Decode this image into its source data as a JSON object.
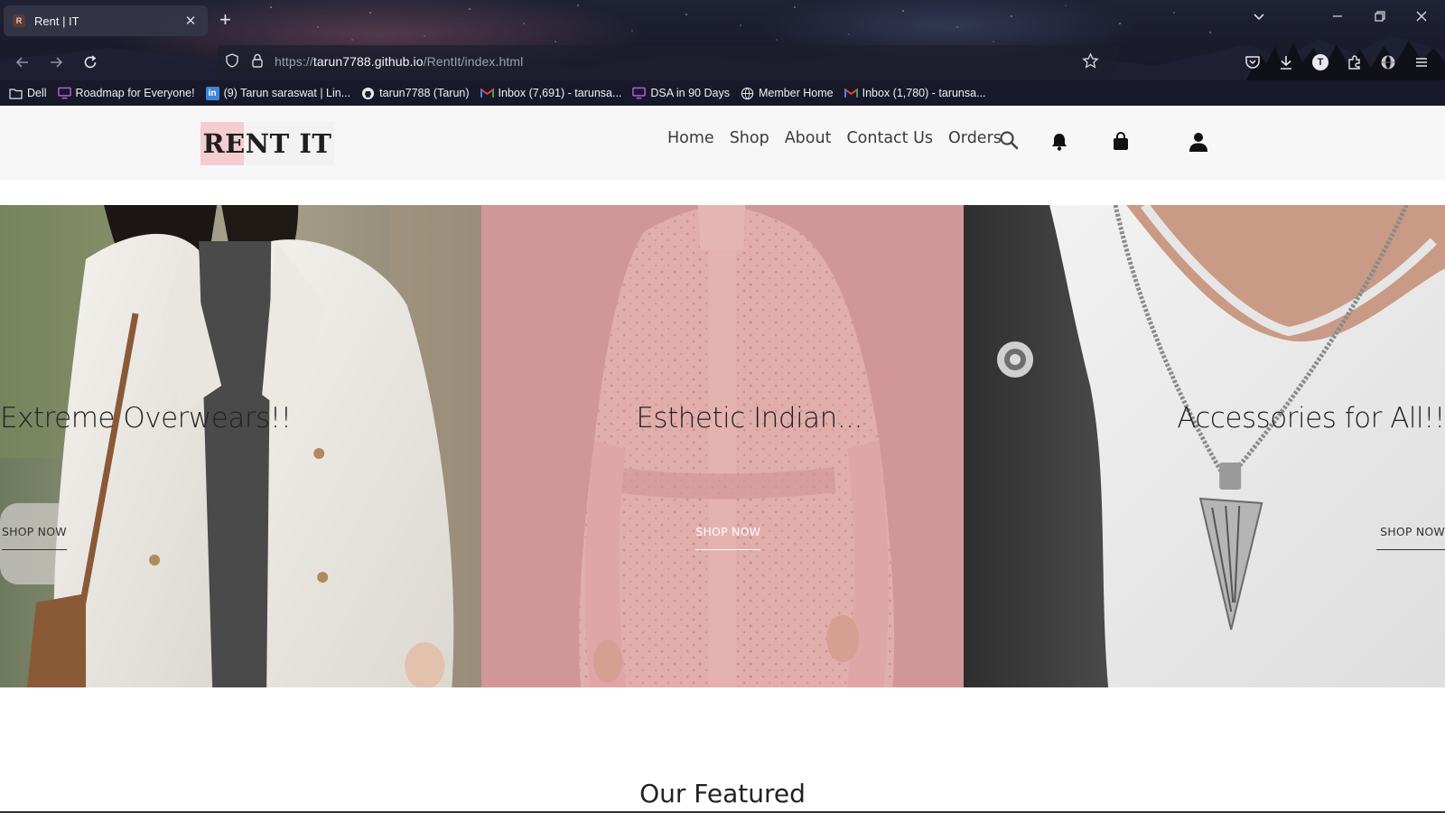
{
  "browser": {
    "tab_title": "Rent | IT",
    "tab_favicon_letter": "R",
    "url_prefix": "https://",
    "url_host": "tarun7788.github.io",
    "url_path": "/RentIt/index.html",
    "bookmarks": [
      {
        "label": "Dell",
        "icon": "folder-icon"
      },
      {
        "label": "Roadmap for Everyone!",
        "icon": "monitor-icon"
      },
      {
        "label": "(9) Tarun saraswat | Lin...",
        "icon": "linkedin-icon"
      },
      {
        "label": "tarun7788 (Tarun)",
        "icon": "github-icon"
      },
      {
        "label": "Inbox (7,691) - tarunsa...",
        "icon": "gmail-icon"
      },
      {
        "label": "DSA in 90 Days",
        "icon": "monitor-icon"
      },
      {
        "label": "Member Home",
        "icon": "globe-icon"
      },
      {
        "label": "Inbox (1,780) - tarunsa...",
        "icon": "gmail-icon"
      }
    ],
    "profile_letter": "T"
  },
  "site": {
    "logo": "RENT IT",
    "nav": [
      "Home",
      "Shop",
      "About",
      "Contact Us",
      "Orders"
    ]
  },
  "hero": {
    "panels": [
      {
        "title": "Extreme Overwears!!",
        "button": "SHOP NOW"
      },
      {
        "title": "Esthetic Indian...",
        "button": "SHOP NOW"
      },
      {
        "title": "Accessories for All!!",
        "button": "SHOP NOW"
      }
    ]
  },
  "featured_heading": "Our Featured",
  "colors": {
    "logo_accent": "#f4ccd2",
    "panel2_bg": "#d19797",
    "nav_bg": "#f7f7f7"
  }
}
